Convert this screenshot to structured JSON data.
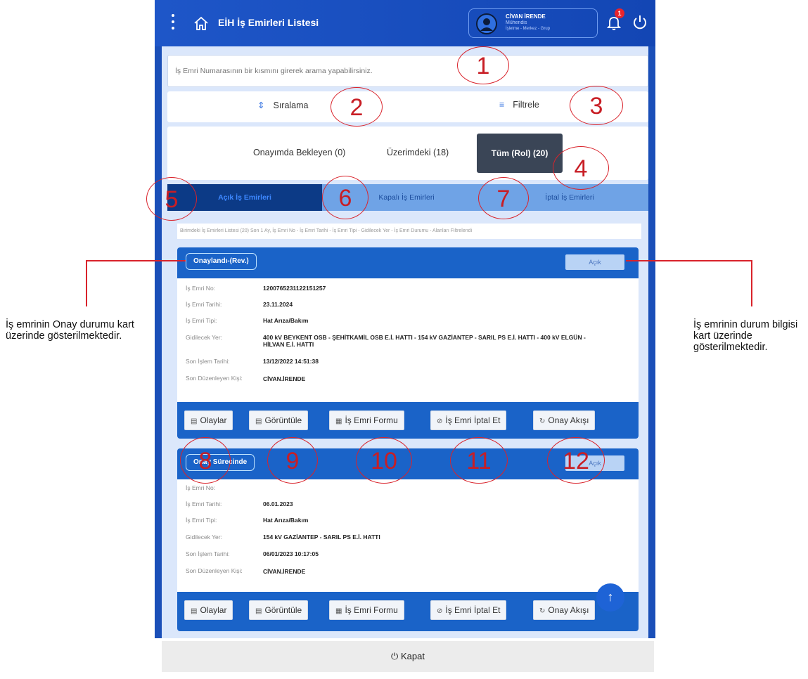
{
  "app": {
    "title": "EİH İş Emirleri Listesi",
    "user_name": "CİVAN İRENDE",
    "user_role": "Mühendis",
    "user_org": "İşletme - Merkez - Grup",
    "notification_count": "1"
  },
  "search": {
    "placeholder": "İş Emri Numarasının bir kısmını girerek arama yapabilirsiniz."
  },
  "toolbar": {
    "sort_label": "Sıralama",
    "filter_label": "Filtrele"
  },
  "role_tabs": {
    "pending": "Onayımda Bekleyen (0)",
    "mine": "Üzerimdeki (18)",
    "all": "Tüm (Rol) (20)"
  },
  "sub_tabs": {
    "open": "Açık İş Emirleri",
    "closed": "Kapalı İş Emirleri",
    "cancelled": "İptal İş Emirleri"
  },
  "filter_info": "Birimdeki İş Emirleri Listesi (20) Son 1 Ay, İş Emri No - İş Emri Tarihi - İş Emri Tipi - Gidilecek Yer - İş Emri Durumu - Alanları Filtrelendi",
  "field_labels": {
    "no": "İş Emri No:",
    "date": "İş Emri Tarihi:",
    "type": "İş Emri Tipi:",
    "location": "Gidilecek Yer:",
    "last_action": "Son İşlem Tarihi:",
    "last_editor": "Son Düzenleyen Kişi:"
  },
  "actions": {
    "events": "Olaylar",
    "view": "Görüntüle",
    "form": "İş Emri Formu",
    "cancel": "İş Emri İptal Et",
    "approval_flow": "Onay Akışı"
  },
  "cards": [
    {
      "approval": "Onaylandı-(Rev.)",
      "status": "Açık",
      "no": "1200765231122151257",
      "date": "23.11.2024",
      "type": "Hat Arıza/Bakım",
      "location": "400 kV BEYKENT OSB - ŞEHİTKAMİL OSB E.İ. HATTI - 154 kV GAZİANTEP - SARIL PS E.İ. HATTI - 400 kV ELGÜN - HİLVAN E.İ. HATTI",
      "last_action": "13/12/2022 14:51:38",
      "last_editor": "CİVAN.İRENDE"
    },
    {
      "approval": "Onay Sürecinde",
      "status": "Açık",
      "no": "",
      "date": "06.01.2023",
      "type": "Hat Arıza/Bakım",
      "location": "154 kV GAZİANTEP - SARIL PS E.İ. HATTI",
      "last_action": "06/01/2023 10:17:05",
      "last_editor": "CİVAN.İRENDE"
    }
  ],
  "footer": {
    "close_label": "Kapat"
  },
  "annotations": {
    "markers": [
      "1",
      "2",
      "3",
      "4",
      "5",
      "6",
      "7",
      "8",
      "9",
      "10",
      "11",
      "12"
    ],
    "left_note": "İş emrinin Onay durumu kart üzerinde gösterilmektedir.",
    "right_note": "İş emrinin durum bilgisi kart üzerinde gösterilmektedir."
  },
  "colors": {
    "primary": "#1a4fb8",
    "annotation_red": "#d9232b",
    "active_tab": "#3a4556"
  }
}
